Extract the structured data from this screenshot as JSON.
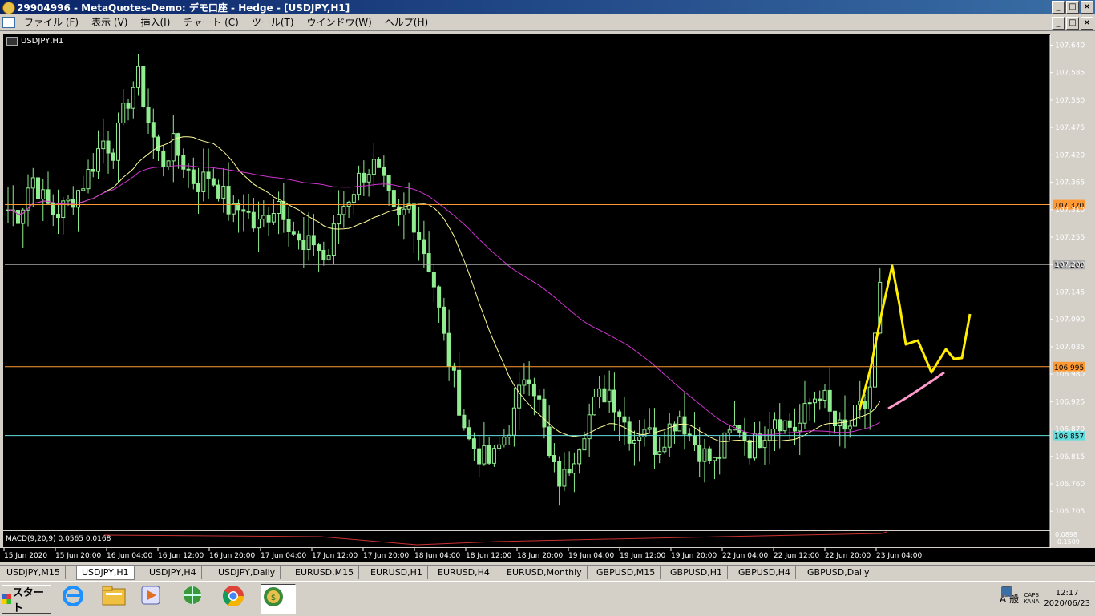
{
  "window": {
    "title": "29904996 - MetaQuotes-Demo: デモ口座 - Hedge - [USDJPY,H1]",
    "controls": {
      "minimize": "_",
      "maximize": "□",
      "close": "×"
    }
  },
  "menubar": {
    "items": [
      "ファイル (F)",
      "表示 (V)",
      "挿入(I)",
      "チャート (C)",
      "ツール(T)",
      "ウインドウ(W)",
      "ヘルプ(H)"
    ]
  },
  "chart": {
    "symbol_label": "USDJPY,H1",
    "colors": {
      "bull": "#90ee90",
      "bear": "#90ee90",
      "ma_fast": "#ffff99",
      "ma_slow": "#cc33cc",
      "drawing_yellow": "#ffee00",
      "drawing_pink": "#ff99cc",
      "line_orange": "#ff9933",
      "line_gray": "#999999",
      "line_cyan": "#66cccc"
    },
    "price_ticks": [
      "107.640",
      "107.585",
      "107.530",
      "107.475",
      "107.420",
      "107.365",
      "107.310",
      "107.255",
      "107.200",
      "107.145",
      "107.090",
      "107.035",
      "106.980",
      "106.925",
      "106.870",
      "106.815",
      "106.760",
      "106.705"
    ],
    "hlines": [
      {
        "label": "107.320",
        "price": 107.32,
        "color": "#ff9933"
      },
      {
        "label": "107.200",
        "price": 107.2,
        "color": "#aaaaaa"
      },
      {
        "label": "106.995",
        "price": 106.995,
        "color": "#ff9933"
      },
      {
        "label": "106.857",
        "price": 106.857,
        "color": "#66dddd"
      }
    ],
    "time_labels": [
      "15 Jun 2020",
      "15 Jun 20:00",
      "16 Jun 04:00",
      "16 Jun 12:00",
      "16 Jun 20:00",
      "17 Jun 04:00",
      "17 Jun 12:00",
      "17 Jun 20:00",
      "18 Jun 04:00",
      "18 Jun 12:00",
      "18 Jun 20:00",
      "19 Jun 04:00",
      "19 Jun 12:00",
      "19 Jun 20:00",
      "22 Jun 04:00",
      "22 Jun 12:00",
      "22 Jun 20:00",
      "23 Jun 04:00"
    ],
    "macd": {
      "label": "MACD(9,20,9) 0.0565 0.0168",
      "ticks": [
        "0.0898",
        "-0.1509"
      ]
    }
  },
  "chart_data": {
    "type": "candlestick",
    "ylim": [
      106.67,
      107.66
    ],
    "closes_path": [
      107.31,
      107.3,
      107.38,
      107.33,
      107.3,
      107.32,
      107.35,
      107.39,
      107.45,
      107.43,
      107.52,
      107.58,
      107.48,
      107.4,
      107.44,
      107.4,
      107.36,
      107.38,
      107.35,
      107.3,
      107.32,
      107.27,
      107.3,
      107.33,
      107.28,
      107.22,
      107.25,
      107.2,
      107.3,
      107.34,
      107.38,
      107.4,
      107.35,
      107.28,
      107.32,
      107.25,
      107.18,
      107.05,
      106.95,
      106.85,
      106.82,
      106.8,
      106.85,
      106.9,
      107.0,
      106.93,
      106.8,
      106.76,
      106.82,
      106.88,
      106.93,
      106.95,
      106.9,
      106.85,
      106.88,
      106.83,
      106.87,
      106.9,
      106.85,
      106.82,
      106.8,
      106.85,
      106.88,
      106.83,
      106.86,
      106.9,
      106.88,
      106.87,
      106.92,
      106.95,
      106.88,
      106.86,
      106.9,
      106.92,
      107.15
    ],
    "ma_fast_desc": "yellow moving average",
    "ma_slow_desc": "magenta moving average"
  },
  "tabs": {
    "items": [
      "USDJPY,M15",
      "USDJPY,H1",
      "USDJPY,H4",
      "USDJPY,Daily",
      "EURUSD,M15",
      "EURUSD,H1",
      "EURUSD,H4",
      "EURUSD,Monthly",
      "GBPUSD,M15",
      "GBPUSD,H1",
      "GBPUSD,H4",
      "GBPUSD,Daily"
    ],
    "active": 1
  },
  "taskbar": {
    "start_label": "スタート",
    "apps": [
      "ie-icon",
      "explorer-icon",
      "media-icon",
      "network-icon",
      "chrome-icon",
      "metatrader-icon"
    ],
    "tray_text": "A 般",
    "caps_label": "CAPS",
    "kana_label": "KANA",
    "clock_time": "12:17",
    "clock_date": "2020/06/23"
  }
}
